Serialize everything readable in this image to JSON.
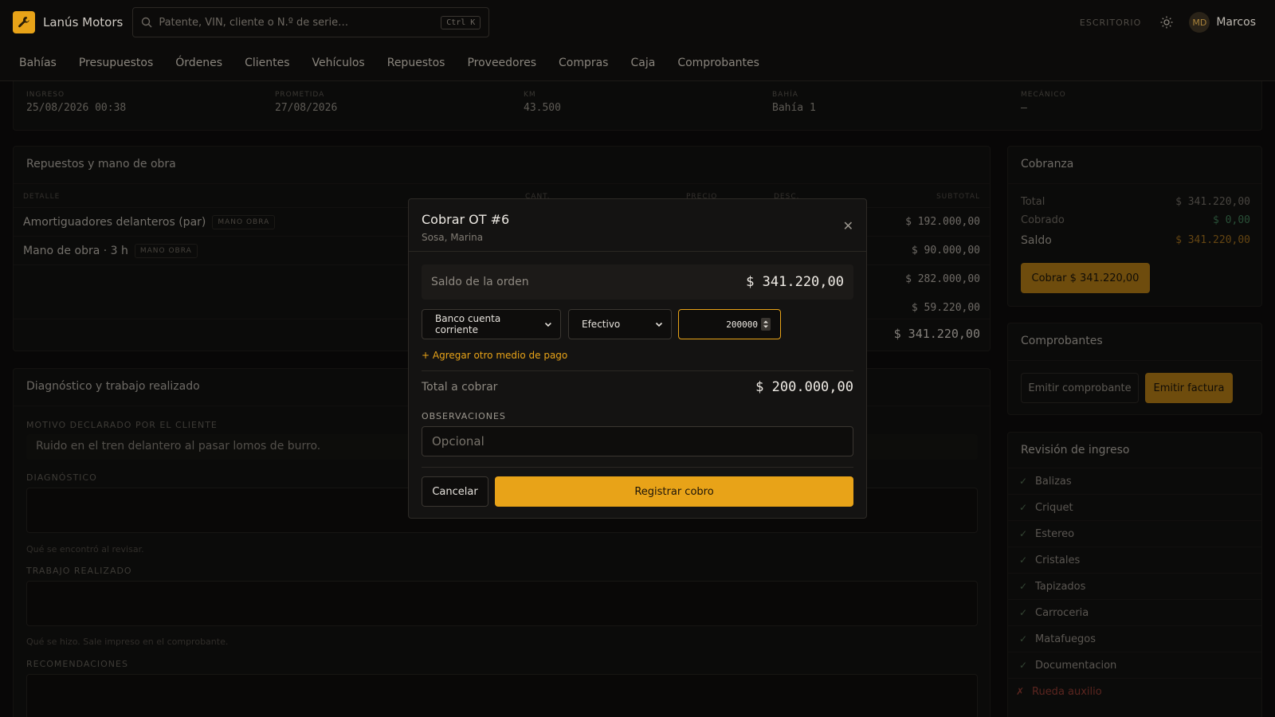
{
  "header": {
    "brand": "Lanús Motors",
    "search_placeholder": "Patente, VIN, cliente o N.º de serie…",
    "search_shortcut": "Ctrl K",
    "mode": "ESCRITORIO",
    "avatar_initials": "MD",
    "user_name": "Marcos"
  },
  "nav": [
    "Bahías",
    "Presupuestos",
    "Órdenes",
    "Clientes",
    "Vehículos",
    "Repuestos",
    "Proveedores",
    "Compras",
    "Caja",
    "Comprobantes"
  ],
  "info": [
    {
      "label": "INGRESO",
      "value": "25/08/2026 00:38"
    },
    {
      "label": "PROMETIDA",
      "value": "27/08/2026"
    },
    {
      "label": "KM",
      "value": "43.500"
    },
    {
      "label": "BAHÍA",
      "value": "Bahía 1"
    },
    {
      "label": "MECÁNICO",
      "value": "–"
    }
  ],
  "parts": {
    "title": "Repuestos y mano de obra",
    "cols": [
      "DETALLE",
      "CANT.",
      "PRECIO",
      "DESC.",
      "SUBTOTAL"
    ],
    "rows": [
      {
        "detail": "Amortiguadores delanteros (par)",
        "tag": "MANO OBRA",
        "subtotal": "$ 192.000,00"
      },
      {
        "detail": "Mano de obra · 3 h",
        "tag": "MANO OBRA",
        "subtotal": "$ 90.000,00"
      }
    ],
    "totals": [
      "$ 282.000,00",
      "$ 59.220,00",
      "$ 341.220,00"
    ]
  },
  "diagnostic": {
    "title": "Diagnóstico y trabajo realizado",
    "motivo_label": "MOTIVO DECLARADO POR EL CLIENTE",
    "motivo_value": "Ruido en el tren delantero al pasar lomos de burro.",
    "diag_label": "DIAGNÓSTICO",
    "diag_hint": "Qué se encontró al revisar.",
    "trabajo_label": "TRABAJO REALIZADO",
    "trabajo_hint": "Qué se hizo. Sale impreso en el comprobante.",
    "recom_label": "RECOMENDACIONES"
  },
  "cobranza": {
    "title": "Cobranza",
    "total_label": "Total",
    "total_value": "$ 341.220,00",
    "cobrado_label": "Cobrado",
    "cobrado_value": "$ 0,00",
    "saldo_label": "Saldo",
    "saldo_value": "$ 341.220,00",
    "button": "Cobrar $ 341.220,00",
    "colors": {
      "cobrado": "#3f7a55",
      "saldo": "#9a6a1c"
    }
  },
  "comprobantes": {
    "title": "Comprobantes",
    "emitir": "Emitir comprobante",
    "factura": "Emitir factura"
  },
  "revision": {
    "title": "Revisión de ingreso",
    "items": [
      {
        "label": "Balizas",
        "ok": true
      },
      {
        "label": "Criquet",
        "ok": true
      },
      {
        "label": "Estereo",
        "ok": true
      },
      {
        "label": "Cristales",
        "ok": true
      },
      {
        "label": "Tapizados",
        "ok": true
      },
      {
        "label": "Carroceria",
        "ok": true
      },
      {
        "label": "Matafuegos",
        "ok": true
      },
      {
        "label": "Documentacion",
        "ok": true
      },
      {
        "label": "Rueda auxilio",
        "ok": false
      }
    ]
  },
  "modal": {
    "title": "Cobrar OT #6",
    "subtitle": "Sosa, Marina",
    "saldo_label": "Saldo de la orden",
    "saldo_value": "$ 341.220,00",
    "account": "Banco cuenta corriente",
    "method": "Efectivo",
    "amount": "200000",
    "add_link": "+ Agregar otro medio de pago",
    "total_label": "Total a cobrar",
    "total_value": "$ 200.000,00",
    "obs_label": "OBSERVACIONES",
    "obs_placeholder": "Opcional",
    "cancel": "Cancelar",
    "submit": "Registrar cobro",
    "accent": "#e8a318"
  }
}
